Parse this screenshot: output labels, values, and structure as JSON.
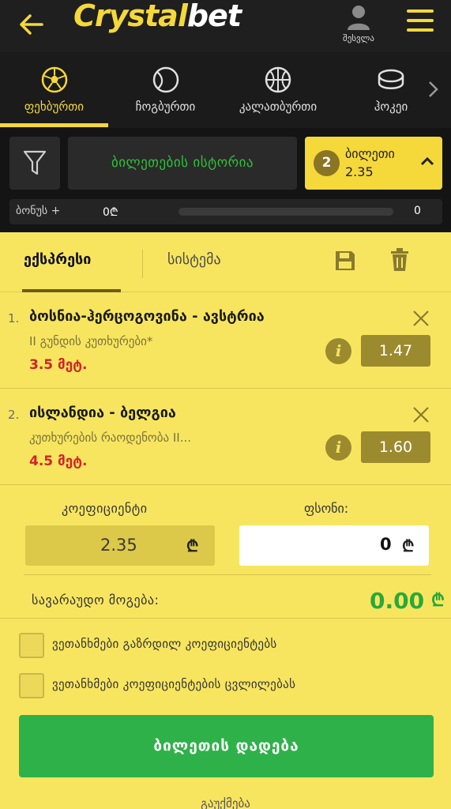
{
  "header": {
    "logo_main": "Crystal",
    "logo_accent": "bet",
    "login_label": "შესვლა"
  },
  "sports": [
    {
      "label": "ფეხბურთი",
      "icon": "soccer-ball-icon",
      "active": true
    },
    {
      "label": "ჩოგბურთი",
      "icon": "tennis-ball-icon",
      "active": false
    },
    {
      "label": "კალათბურთი",
      "icon": "basketball-icon",
      "active": false
    },
    {
      "label": "ჰოკეი",
      "icon": "hockey-puck-icon",
      "active": false
    }
  ],
  "strip": {
    "history_label": "ბილეთების ისტორია",
    "ticket_count": "2",
    "ticket_label": "ბილეთი",
    "ticket_odds": "2.35",
    "bonus_label": "ბონუს +",
    "bonus_value": "0₾",
    "bonus_max": "0",
    "bonus_progress": 0
  },
  "tabs": {
    "express": "ექსპრესი",
    "system": "სისტემა"
  },
  "selections": [
    {
      "number": "1.",
      "title": "ბოსნია-ჰერცოგოვინა - ავსტრია",
      "market": "II გუნდის კუთხურები*",
      "pick": "3.5 მეტ.",
      "odds": "1.47"
    },
    {
      "number": "2.",
      "title": "ისლანდია - ბელგია",
      "market": "კუთხურების რაოდენობა II...",
      "pick": "4.5 მეტ.",
      "odds": "1.60"
    }
  ],
  "calc": {
    "coef_label": "კოეფიციენტი",
    "coef_value": "2.35",
    "stake_label": "ფსონი:",
    "stake_value": "0",
    "currency": "₾",
    "win_label": "სავარაუდო მოგება:",
    "win_value": "0.00"
  },
  "options": {
    "accept_increased": "ვეთანხმები გაზრდილ კოეფიციენტებს",
    "accept_changes": "ვეთანხმები კოეფიციენტების ცვლილებას"
  },
  "actions": {
    "place_bet": "ბილეთის დადება",
    "cancel": "გაუქმება"
  },
  "colors": {
    "accent": "#f5d83a",
    "panel": "#f7e560",
    "green": "#2fb14a",
    "red": "#d3232a"
  }
}
